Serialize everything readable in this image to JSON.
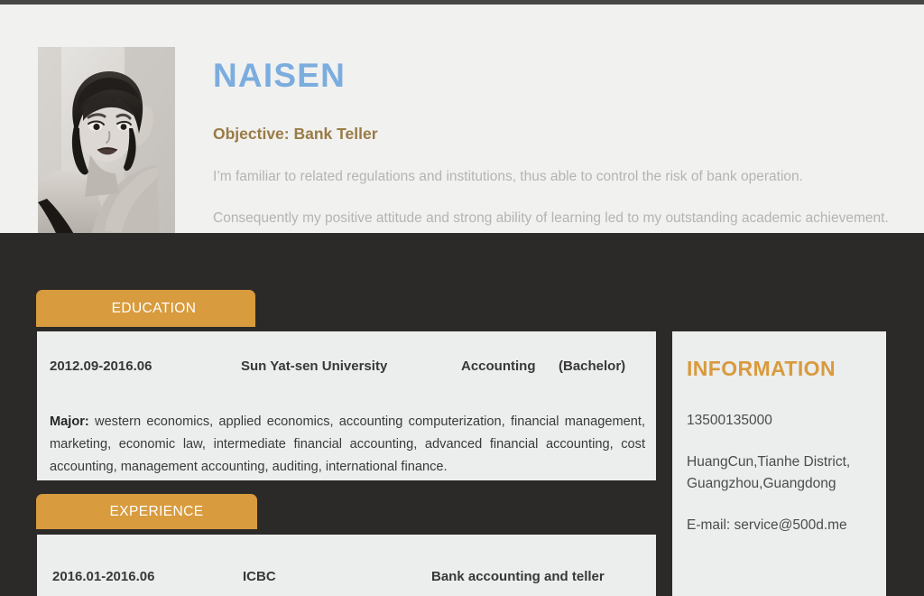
{
  "document": {
    "type": "resume",
    "accent_orange": "#d89b3d",
    "accent_blue": "#7badde",
    "dark_bg": "#2b2a28",
    "light_bg": "#f1f1f0",
    "card_bg": "#eceded"
  },
  "header": {
    "photo_alt": "portrait-photo",
    "name": "NAISEN",
    "objective": "Objective: Bank Teller",
    "summary_paragraph_1": "I’m familiar to related regulations and institutions, thus able to control the risk of bank operation.",
    "summary_paragraph_2": "Consequently my positive attitude and strong ability of learning led to my outstanding academic achievement."
  },
  "education": {
    "tab_label": "EDUCATION",
    "entry": {
      "dates": "2012.09-2016.06",
      "school": "Sun Yat-sen University",
      "major": "Accounting",
      "degree": "(Bachelor)"
    },
    "detail_label": "Major:",
    "detail_text": " western economics, applied economics, accounting computerization, financial management, marketing, economic law, intermediate financial accounting, advanced financial accounting, cost accounting, management accounting, auditing, international finance."
  },
  "experience": {
    "tab_label": "EXPERIENCE",
    "entry": {
      "dates": "2016.01-2016.06",
      "organization": "ICBC",
      "role": "Bank accounting and teller"
    }
  },
  "information": {
    "title": "INFORMATION",
    "phone": "13500135000",
    "address": "HuangCun,Tianhe   District, Guangzhou,Guangdong",
    "email": "E-mail: service@500d.me"
  }
}
